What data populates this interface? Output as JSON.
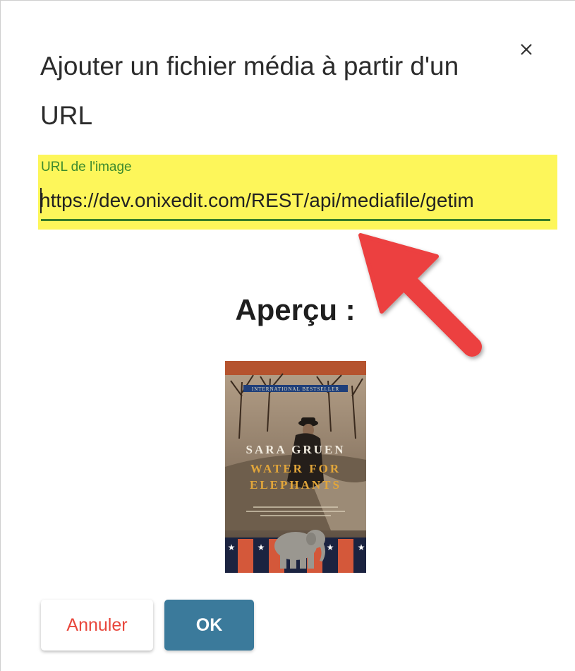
{
  "dialog": {
    "title": "Ajouter un fichier média à partir d'un URL",
    "close_symbol": "×"
  },
  "url_field": {
    "label": "URL de l'image",
    "value": "https://dev.onixedit.com/REST/api/mediafile/getim",
    "highlight_color": "#fdf65a"
  },
  "annotation": {
    "icon": "red-arrow-icon",
    "color": "#ec3f40"
  },
  "preview": {
    "title": "Aperçu :",
    "book_cover": {
      "banner": "INTERNATIONAL BESTSELLER",
      "author": "SARA GRUEN",
      "title_line1": "WATER FOR",
      "title_line2": "ELEPHANTS"
    }
  },
  "buttons": {
    "cancel_label": "Annuler",
    "ok_label": "OK"
  },
  "colors": {
    "accent_green": "#3d8a2e",
    "cancel_red": "#e8463b",
    "ok_blue": "#3b7a9b"
  }
}
